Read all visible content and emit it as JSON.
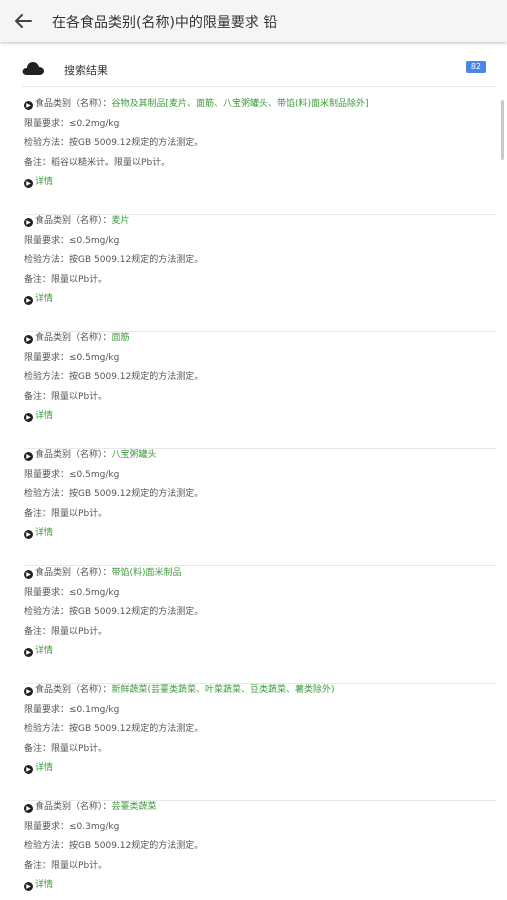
{
  "header": {
    "title": "在各食品类别(名称)中的限量要求 铅"
  },
  "results": {
    "label": "搜索结果",
    "count": "82"
  },
  "labels": {
    "category": "食品类别（名称）：",
    "limit": "限量要求：",
    "method": "检验方法：",
    "note": "备注：",
    "detail": "详情"
  },
  "items": [
    {
      "category": "谷物及其制品[麦片、面筋、八宝粥罐头、带馅(料)面米制品除外]",
      "limit": "≤0.2mg/kg",
      "method": "按GB 5009.12规定的方法测定。",
      "note": "稻谷以糙米计。限量以Pb计。"
    },
    {
      "category": "麦片",
      "limit": "≤0.5mg/kg",
      "method": "按GB 5009.12规定的方法测定。",
      "note": "限量以Pb计。"
    },
    {
      "category": "面筋",
      "limit": "≤0.5mg/kg",
      "method": "按GB 5009.12规定的方法测定。",
      "note": "限量以Pb计。"
    },
    {
      "category": "八宝粥罐头",
      "limit": "≤0.5mg/kg",
      "method": "按GB 5009.12规定的方法测定。",
      "note": "限量以Pb计。"
    },
    {
      "category": "带馅(料)面米制品",
      "limit": "≤0.5mg/kg",
      "method": "按GB 5009.12规定的方法测定。",
      "note": "限量以Pb计。"
    },
    {
      "category": "新鲜蔬菜(芸薹类蔬菜、叶菜蔬菜、豆类蔬菜、薯类除外)",
      "limit": "≤0.1mg/kg",
      "method": "按GB 5009.12规定的方法测定。",
      "note": "限量以Pb计。"
    },
    {
      "category": "芸薹类蔬菜",
      "limit": "≤0.3mg/kg",
      "method": "按GB 5009.12规定的方法测定。",
      "note": "限量以Pb计。"
    }
  ]
}
